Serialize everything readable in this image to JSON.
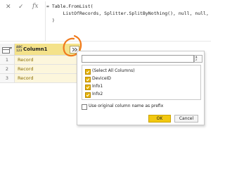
{
  "formula_bar": {
    "cancel_icon": "✕",
    "confirm_icon": "✓",
    "fx_label": "fx",
    "formula_text": "= Table.FromList(\n      ListOfRecords, Splitter.SplitByNothing(), null, null,\n  )"
  },
  "grid": {
    "column_type_icon": "ABC\n123",
    "column_name": "Column1",
    "rows": [
      {
        "num": "1",
        "value": "Record"
      },
      {
        "num": "2",
        "value": "Record"
      },
      {
        "num": "3",
        "value": "Record"
      }
    ]
  },
  "expand_popup": {
    "search_value": "",
    "sort_icon_top": "A",
    "sort_icon_bottom": "Z",
    "columns": [
      {
        "label": "(Select All Columns)",
        "checked": true
      },
      {
        "label": "DeviceID",
        "checked": true
      },
      {
        "label": "Info1",
        "checked": true
      },
      {
        "label": "Info2",
        "checked": true
      }
    ],
    "prefix_label": "Use original column name as prefix",
    "prefix_checked": false,
    "ok_label": "OK",
    "cancel_label": "Cancel"
  },
  "colors": {
    "accent_yellow": "#f2c811",
    "column_header": "#f4e28a",
    "annotation_orange": "#f07a1c"
  }
}
